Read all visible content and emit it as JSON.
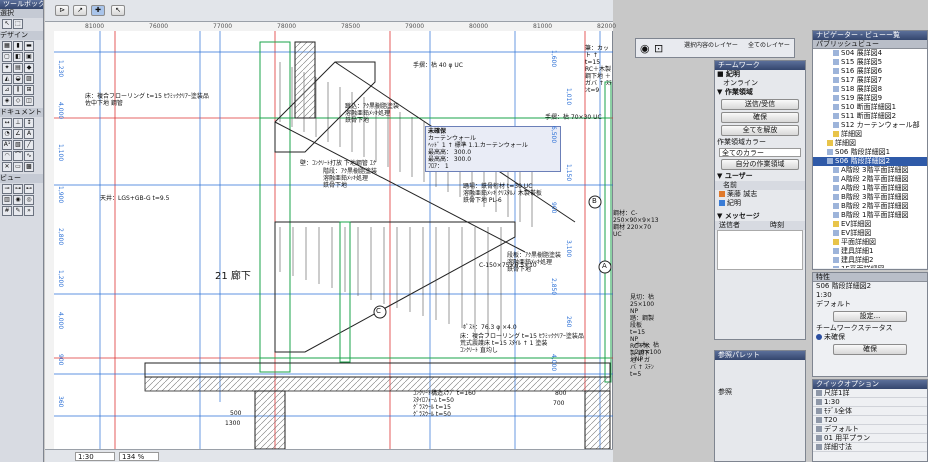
{
  "toolbox": {
    "title": "ツールボックス",
    "select": "選択",
    "design": "デザイン",
    "document": "ドキュメント",
    "view": "ビュー"
  },
  "drawing": {
    "dims_top": [
      "81000",
      "76000",
      "77000",
      "78000",
      "78500",
      "79000",
      "80000",
      "81000",
      "82000"
    ],
    "dims_left": [
      "1,230",
      "4,000",
      "1,100",
      "1,900",
      "2,800",
      "1,200",
      "4,000",
      "900",
      "360"
    ],
    "dims_right": [
      "1,600",
      "1,010",
      "6,500",
      "1,150",
      "900",
      "3,100",
      "2,850",
      "260",
      "4,000"
    ],
    "dims_bottom": [
      "500",
      "1300",
      "800",
      "700"
    ],
    "annotations": {
      "floor_upper": "床：複合フローリング t=15 ｾﾗﾐｯｸｸﾘｱｰ塗装品",
      "floor_upper2": "佐中下地 鋼管",
      "handrail_top": "手摺：枯 40 φ UC",
      "bar_top": "筆：カット ↑ t=15",
      "bar_top2": "RC＋木製 鋼下地 ＋ガバ ↑ ｽﾃﾝt=9",
      "leg_paint": "蹴込：ｱｸ黒樹脂塗装",
      "leg_paint2": "溶融亜鉛ﾒｯｷ処理",
      "leg_paint3": "鉄骨下地",
      "wall_stone": "壁：ｺﾝｸﾘｰﾄ打放 下地鋼管 ｴｸ",
      "stair_paint": "階段：ｱｸ黒樹脂塗装",
      "stair_paint2": "溶融亜鉛ﾒｯｷ処理",
      "stair_paint3": "鉄骨下地",
      "ceiling": "天井：LGS+GB-G t=9.5",
      "handrail_r": "手摺：枯 70×30 UC",
      "baluster": "手摺子：枯 ↑ 12×35 UC",
      "stringer": "踊場：鉄骨桁材 t=30 UC",
      "stringer2": "溶融亜鉛ﾒｯｷ ｸﾘｽﾀﾙﾉ 木製帯板",
      "stringer3": "鉄骨下地 PL-6",
      "beam1": "鋼材：C-250×90×9×13",
      "beam2": "鋼材 220×70 UC",
      "channel": "C-150×75×6.5×10",
      "stair2": "段板：ｱｸ黒樹脂塗装",
      "stair2b": "溶融亜鉛ﾒｯｷ処理",
      "stair2c": "鉄骨下地",
      "sash": "見切：枯 25×100 NP",
      "sash2": "踏：鋼製段板 t=15 NP",
      "sash3": "RC＋木製 鋼下地 ＋ガバ ↑ ｽﾃﾝt=5",
      "pole": "ﾎﾟｽﾄ：76.3 φ ×4.0",
      "floor_low": "床：複合フローリング t=15 ｾﾗﾐｯｸｸﾘｱｰ塗装品",
      "floor_low2": "荒式震護床 t=15 ｽﾀｲﾙ  ↑ 1 塗装",
      "floor_low3": "ｺﾝｸﾘｰﾄ 直均し",
      "slab": "ｺﾝｸﾘｰﾄ構造ｽﾗﾌﾞ t=160",
      "slab2": "ｽﾀｲﾛﾌｫｰﾑ t=50",
      "slab3": "ｸﾞﾗｽｳｰﾙ t=15",
      "slab4": "ｸﾞﾗｽｳｰﾙ t=50",
      "skirting": "巾木：枯 2.0×100 NP",
      "room": "21 廊下",
      "marker_a": "A",
      "marker_b": "B",
      "marker_c": "C",
      "dim_small": "200",
      "dim_small2": "1,190"
    },
    "tooltip": {
      "title": "未確保",
      "sub": "カーテンウォール",
      "l1": "ﾍｯﾄﾞ 1 ↑ 標準 1.1.カーテンウォール",
      "l2": "最高高： 300.0",
      "l3": "最高高： 300.0",
      "l4": "ﾌﾛｱ： 1",
      "extra": "1,4,ﾃﾝ φ135 UC"
    },
    "level_labels": [
      "▽",
      "▽",
      "▽",
      "▽"
    ]
  },
  "statusbar": {
    "zoom": "1:30",
    "percent": "134 %"
  },
  "teamwork": {
    "title": "チームワーク",
    "section_login": "■ 紀明",
    "online": "オンライン",
    "section_ops": "▼ 作業領域",
    "send_receive": "送信/受信",
    "reserve": "確保",
    "release_all": "全てを解放",
    "workspace_color": "作業領域カラー",
    "all_colors": "全てのカラー",
    "own_area": "自分の作業領域",
    "section_users": "▼ ユーザー",
    "user_name_hdr": "名前",
    "user1": "薬藤 誠志",
    "user2": "紀明",
    "section_msg": "▼ メッセージ",
    "msg_from": "送信者",
    "msg_time": "時刻"
  },
  "layer_bar": {
    "title": "選択内容のレイヤー",
    "all_layers": "全てのレイヤー"
  },
  "params": {
    "title": "参照パレット",
    "ref": "参照"
  },
  "navigator": {
    "title": "ナビゲーター - ビューー覧",
    "publisher": "パブリッシュビュー",
    "items": [
      "S04 展詳図4",
      "S15 展詳図5",
      "S16 展詳図6",
      "S17 展詳図7",
      "S18 展詳図8",
      "S19 展詳図9",
      "S10 断面詳細図1",
      "S11 断面詳細図2",
      "S12 カーテンウォール部",
      "詳細図",
      "詳細図",
      "S06 階段詳細図1",
      "S06 階段詳細図2",
      "A階段 3階平面詳細図",
      "A階段 2階平面詳細図",
      "A階段 1階平面詳細図",
      "B階段 3階平面詳細図",
      "B階段 2階平面詳細図",
      "B階段 1階平面詳細図",
      "EV詳細図",
      "EV詳細図",
      "平面詳細図",
      "建具詳細1",
      "建具詳細2",
      "1F平面詳細図"
    ]
  },
  "props": {
    "title": "特性",
    "view_no": "S06",
    "view_name": "階段詳細図2",
    "scale": "1:30",
    "def": "デフォルト",
    "settings": "設定...",
    "teamwork_status": "チームワークステータス",
    "status_val": "未確保",
    "reserve": "確保"
  },
  "quickopts": {
    "title": "クイックオプション",
    "rows": [
      "尺詳1詳",
      "1:30",
      "ﾓﾃﾞﾙ全体",
      "T20",
      "デフォルト",
      "01 用平プラン",
      "詳細寸法"
    ]
  }
}
